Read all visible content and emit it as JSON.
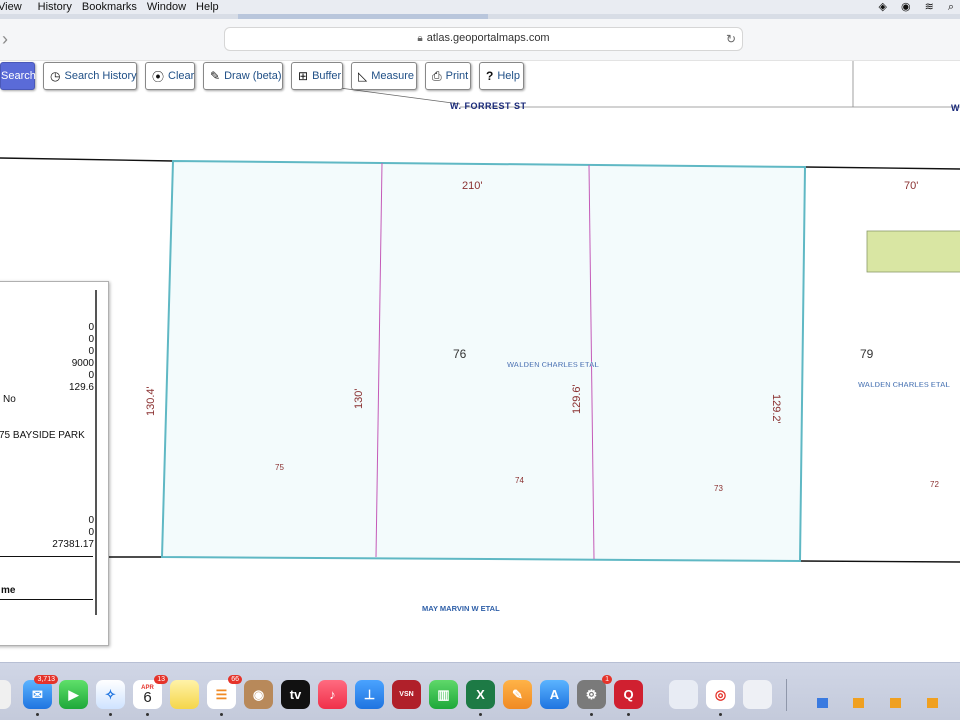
{
  "menubar": {
    "items": [
      "View",
      "History",
      "Bookmarks",
      "Window",
      "Help"
    ]
  },
  "browser": {
    "url": "atlas.geoportalmaps.com"
  },
  "tools": {
    "search": "Search",
    "search_history": "Search History",
    "clear": "Clear",
    "draw": "Draw (beta)",
    "buffer": "Buffer",
    "measure": "Measure",
    "print": "Print",
    "help": "Help"
  },
  "map": {
    "street_top": "W. FORREST ST",
    "street_top_right": "W",
    "owner_bottom": "MAY MARVIN W ETAL",
    "owner_76": "WALDEN CHARLES ETAL",
    "owner_79": "WALDEN CHARLES ETAL",
    "parcel_76": "76",
    "parcel_79": "79",
    "lot_75": "75",
    "lot_74": "74",
    "lot_73": "73",
    "lot_72": "72",
    "dim_top": "210'",
    "dim_top_right": "70'",
    "dim_left": "130.4'",
    "dim_lot75_74": "130'",
    "dim_lot74_73": "129.6'",
    "dim_right": "129.2'",
    "highlight_fill": "#f3fbfc",
    "highlight_stroke": "#5fb8c4"
  },
  "panel": {
    "v1": "0",
    "v2": "0",
    "v3": "0",
    "v4": "9000",
    "v5": "0",
    "v6": "129.6",
    "flag": "No",
    "address": "75 BAYSIDE PARK",
    "v7": "0",
    "v8": "0",
    "v9": "27381.17",
    "footer": "me"
  },
  "dock": {
    "mail_badge": "3,713",
    "calendar_month": "APR",
    "calendar_day": "6",
    "calendar_badge": "13",
    "reminders_badge": "66",
    "settings_badge": "1"
  }
}
